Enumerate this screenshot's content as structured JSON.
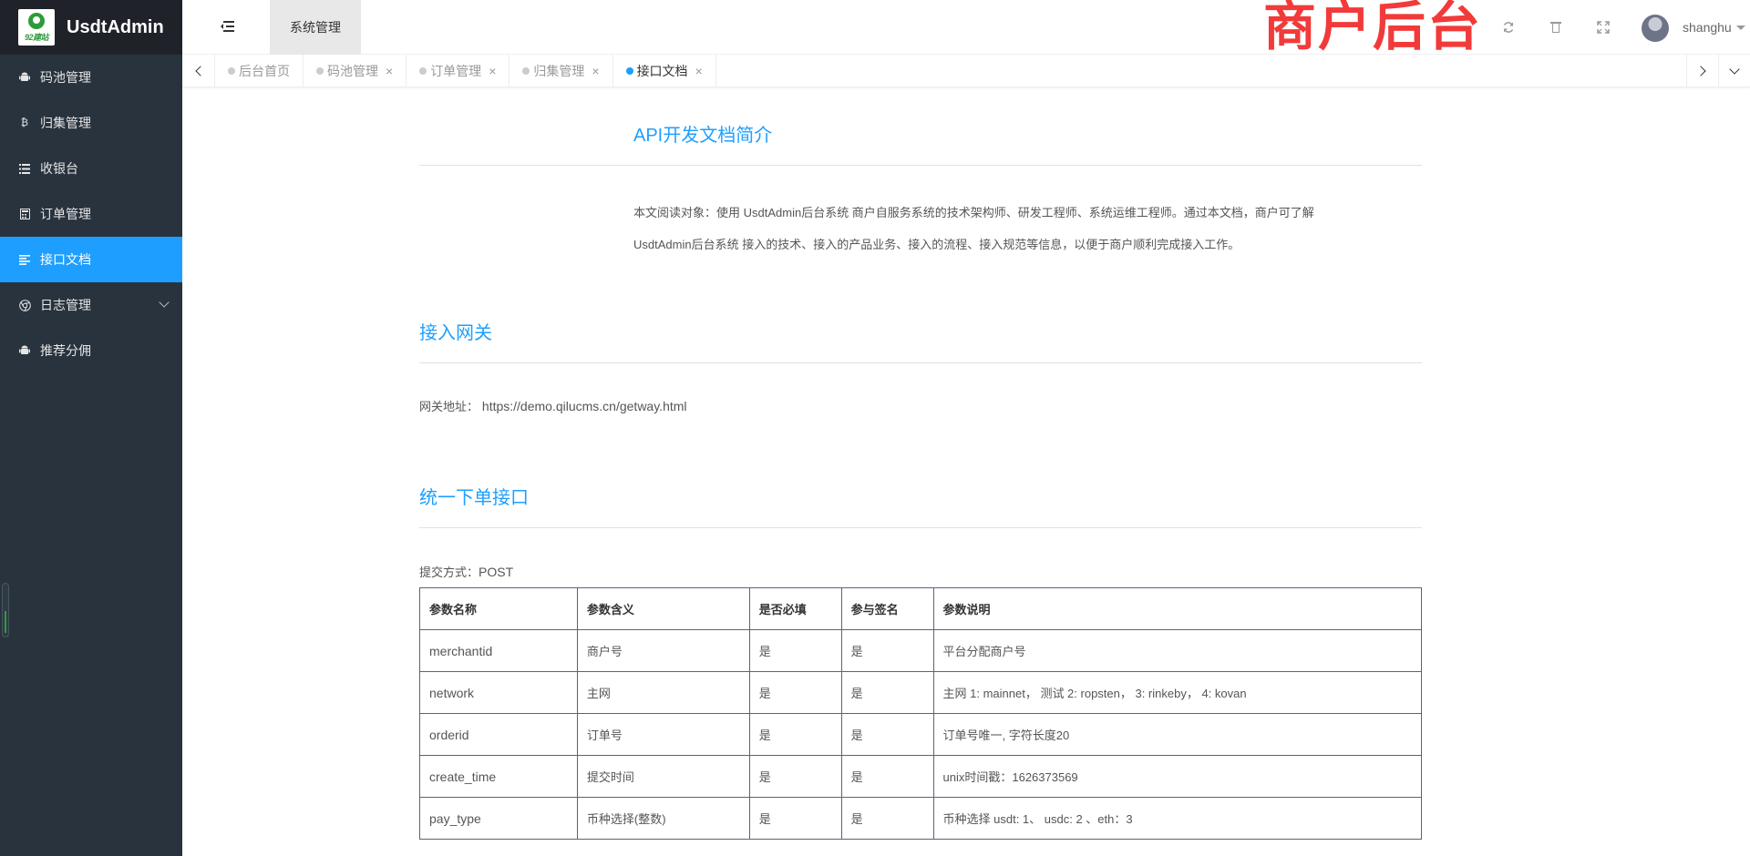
{
  "app": {
    "title": "UsdtAdmin",
    "logo_text": "92建站"
  },
  "sidebar": {
    "items": [
      {
        "label": "码池管理",
        "icon": "android-icon"
      },
      {
        "label": "归集管理",
        "icon": "bitcoin-icon"
      },
      {
        "label": "收银台",
        "icon": "list-icon"
      },
      {
        "label": "订单管理",
        "icon": "calculator-icon"
      },
      {
        "label": "接口文档",
        "icon": "align-left-icon",
        "active": true
      },
      {
        "label": "日志管理",
        "icon": "chrome-icon",
        "has_children": true
      },
      {
        "label": "推荐分佣",
        "icon": "android-icon"
      }
    ]
  },
  "header": {
    "system_tab": "系统管理",
    "brand": "商户后台",
    "username": "shanghu",
    "icons": [
      "menu-toggle-icon",
      "refresh-icon",
      "trash-icon",
      "fullscreen-icon"
    ]
  },
  "tabs": [
    {
      "label": "后台首页",
      "closable": false
    },
    {
      "label": "码池管理",
      "closable": true
    },
    {
      "label": "订单管理",
      "closable": true
    },
    {
      "label": "归集管理",
      "closable": true
    },
    {
      "label": "接口文档",
      "closable": true,
      "active": true
    }
  ],
  "doc": {
    "intro_title": "API开发文档简介",
    "intro_line1": "本文阅读对象：使用 UsdtAdmin后台系统 商户自服务系统的技术架构师、研发工程师、系统运维工程师。通过本文档，商户可了解",
    "intro_line2": "UsdtAdmin后台系统 接入的技术、接入的产品业务、接入的流程、接入规范等信息，以便于商户顺利完成接入工作。",
    "gateway_title": "接入网关",
    "gateway_label": "网关地址：",
    "gateway_url": "https://demo.qilucms.cn/getway.html",
    "order_title": "统一下单接口",
    "submit_label": "提交方式：",
    "submit_method": "POST",
    "table": {
      "headers": [
        "参数名称",
        "参数含义",
        "是否必填",
        "参与签名",
        "参数说明"
      ],
      "rows": [
        [
          "merchantid",
          "商户号",
          "是",
          "是",
          "平台分配商户号"
        ],
        [
          "network",
          "主网",
          "是",
          "是",
          "主网 1: mainnet， 测试 2: ropsten， 3: rinkeby， 4: kovan"
        ],
        [
          "orderid",
          "订单号",
          "是",
          "是",
          "订单号唯一, 字符长度20"
        ],
        [
          "create_time",
          "提交时间",
          "是",
          "是",
          "unix时间戳：1626373569"
        ],
        [
          "pay_type",
          "币种选择(整数)",
          "是",
          "是",
          "币种选择 usdt: 1、 usdc: 2 、eth：3"
        ]
      ]
    }
  }
}
